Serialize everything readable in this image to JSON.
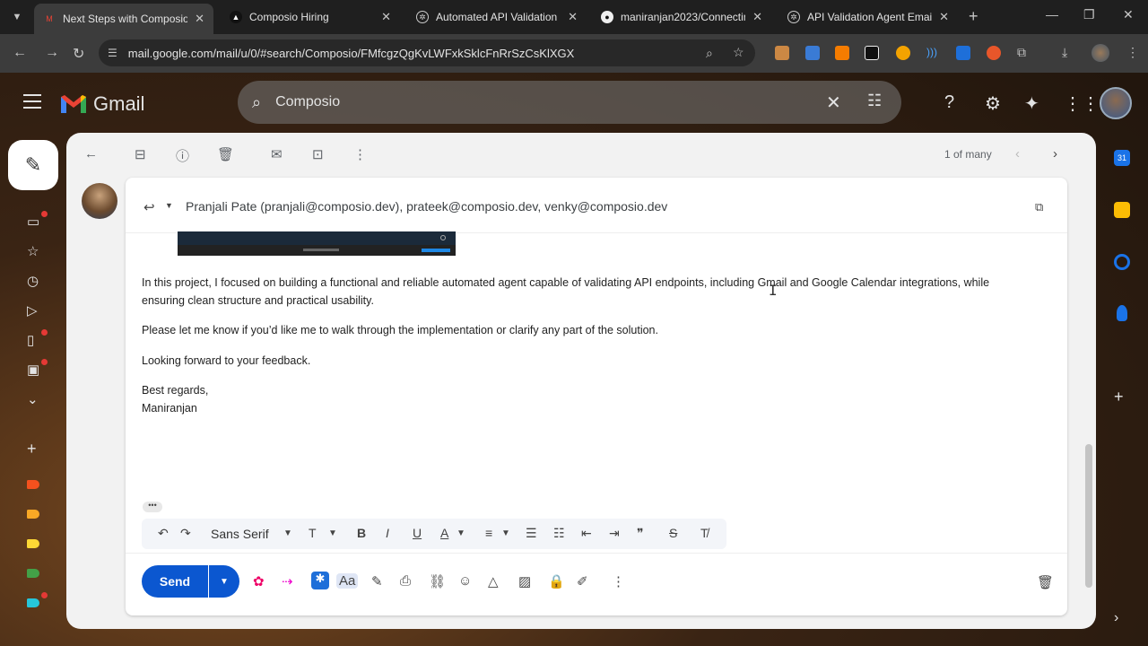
{
  "browser": {
    "tabs": [
      {
        "title": "Next Steps with Composio |",
        "active": true
      },
      {
        "title": "Composio Hiring",
        "active": false
      },
      {
        "title": "Automated API Validation D",
        "active": false
      },
      {
        "title": "maniranjan2023/Connecting",
        "active": false
      },
      {
        "title": "API Validation Agent Email",
        "active": false
      }
    ],
    "url": "mail.google.com/mail/u/0/#search/Composio/FMfcgzQgKvLWFxkSklcFnRrSzCsKlXGX"
  },
  "gmail": {
    "logo_text": "Gmail",
    "search_value": "Composio",
    "pager_text": "1 of many"
  },
  "email": {
    "recipients": "Pranjali Pate (pranjali@composio.dev), prateek@composio.dev, venky@composio.dev",
    "paragraph1_line1": "In this project, I focused on building a functional and reliable automated agent capable of validating API endpoints, including Gmail and Google Calendar integrations, while",
    "paragraph1_line2": "ensuring clean structure and practical usability.",
    "paragraph2": "Please let me know if you’d like me to walk through the implementation or clarify any part of the solution.",
    "paragraph3": "Looking forward to your feedback.",
    "closing": "Best regards,",
    "signature": "Maniranjan"
  },
  "formatting": {
    "font_name": "Sans Serif"
  },
  "compose_actions": {
    "send_label": "Send"
  },
  "colors": {
    "send_blue": "#0b57d0",
    "gmail_red": "#ea4335"
  }
}
